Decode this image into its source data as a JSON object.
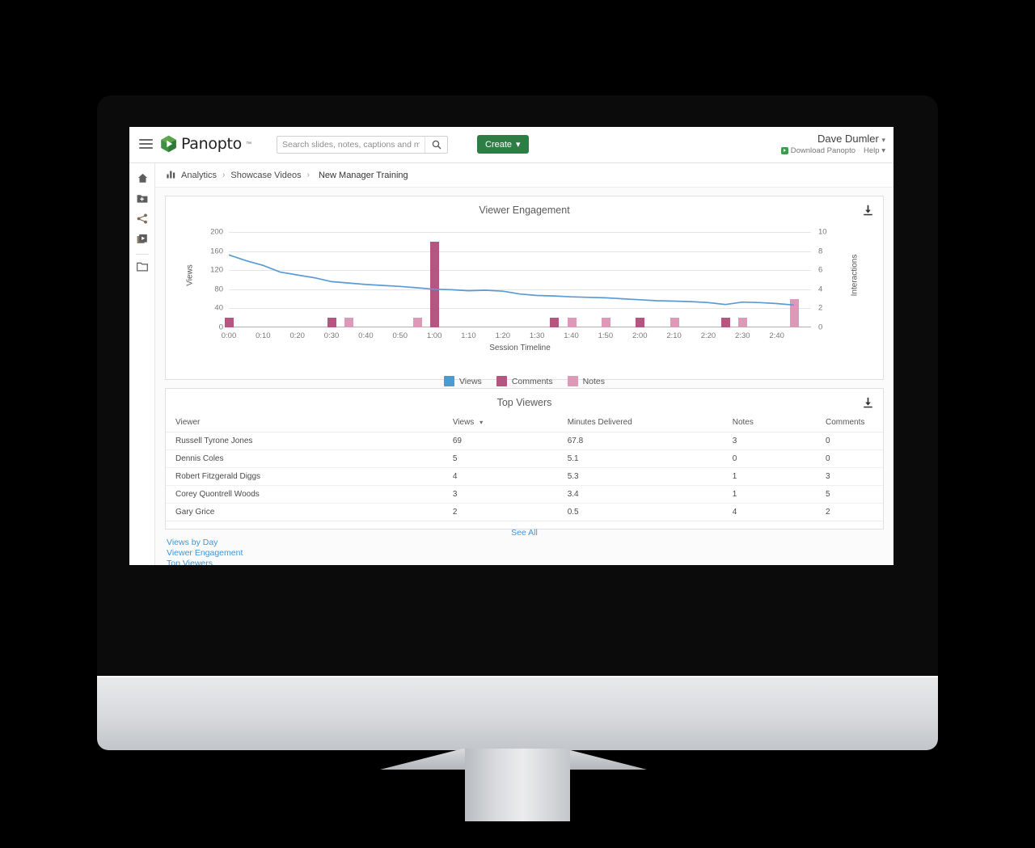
{
  "header": {
    "menu_icon": "hamburger-icon",
    "logo_text": "Panopto",
    "logo_tm": "™",
    "search_placeholder": "Search slides, notes, captions and more",
    "search_value": "",
    "search_icon": "search-icon",
    "create_label": "Create",
    "create_caret": "▾",
    "user_name": "Dave Dumler",
    "user_caret": "▾",
    "download_label": "Download Panopto",
    "help_label": "Help",
    "help_caret": "▾"
  },
  "sidebar": {
    "items": [
      {
        "icon": "home-icon",
        "name": "home"
      },
      {
        "icon": "add-folder-icon",
        "name": "my-folder"
      },
      {
        "icon": "share-icon",
        "name": "shared-with-me"
      },
      {
        "icon": "sessions-icon",
        "name": "everything"
      },
      {
        "icon": "folder-icon",
        "name": "browse-folder"
      }
    ]
  },
  "breadcrumb": {
    "icon": "analytics-bars-icon",
    "items": [
      "Analytics",
      "Showcase Videos",
      "New Manager Training"
    ],
    "separator": "›"
  },
  "chart_card": {
    "title": "Viewer Engagement",
    "download_icon": "download-icon"
  },
  "chart_data": {
    "type": "line",
    "title": "Viewer Engagement",
    "xlabel": "Session Timeline",
    "ylabel": "Views",
    "y2label": "Interactions",
    "ylim": [
      0,
      200
    ],
    "y2lim": [
      0,
      10
    ],
    "yticks": [
      0,
      40,
      80,
      120,
      160,
      200
    ],
    "y2ticks": [
      0,
      2,
      4,
      6,
      8,
      10
    ],
    "xticks": [
      "0:00",
      "0:10",
      "0:20",
      "0:30",
      "0:40",
      "0:50",
      "1:00",
      "1:10",
      "1:20",
      "1:30",
      "1:40",
      "1:50",
      "2:00",
      "2:10",
      "2:20",
      "2:30",
      "2:40"
    ],
    "xlim_minutes": [
      0,
      2.83
    ],
    "grid": true,
    "legend_position": "bottom",
    "series": [
      {
        "name": "Views",
        "type": "line",
        "color": "#5b9bd5",
        "x": [
          "0:00",
          "0:05",
          "0:10",
          "0:15",
          "0:20",
          "0:25",
          "0:30",
          "0:35",
          "0:40",
          "0:45",
          "0:50",
          "0:55",
          "1:00",
          "1:05",
          "1:10",
          "1:15",
          "1:20",
          "1:25",
          "1:30",
          "1:35",
          "1:40",
          "1:45",
          "1:50",
          "1:55",
          "2:00",
          "2:05",
          "2:10",
          "2:15",
          "2:20",
          "2:25",
          "2:30",
          "2:35",
          "2:40",
          "2:45"
        ],
        "values": [
          152,
          140,
          130,
          116,
          110,
          104,
          96,
          93,
          90,
          88,
          86,
          83,
          80,
          79,
          77,
          78,
          76,
          70,
          67,
          66,
          64,
          63,
          62,
          60,
          58,
          56,
          55,
          54,
          52,
          48,
          53,
          52,
          50,
          47
        ]
      },
      {
        "name": "Comments",
        "type": "bar",
        "color": "#b4567f",
        "points": [
          {
            "x": "0:00",
            "value": 1
          },
          {
            "x": "0:30",
            "value": 1
          },
          {
            "x": "1:00",
            "value": 9
          },
          {
            "x": "1:35",
            "value": 1
          },
          {
            "x": "2:00",
            "value": 1
          },
          {
            "x": "2:25",
            "value": 1
          }
        ]
      },
      {
        "name": "Notes",
        "type": "bar",
        "color": "#dd9ab8",
        "points": [
          {
            "x": "0:35",
            "value": 1
          },
          {
            "x": "0:55",
            "value": 1
          },
          {
            "x": "1:40",
            "value": 1
          },
          {
            "x": "1:50",
            "value": 1
          },
          {
            "x": "2:10",
            "value": 1
          },
          {
            "x": "2:30",
            "value": 1
          },
          {
            "x": "2:45",
            "value": 3
          }
        ]
      }
    ],
    "legend": [
      {
        "label": "Views",
        "color": "#4a9bd1"
      },
      {
        "label": "Comments",
        "color": "#b4567f"
      },
      {
        "label": "Notes",
        "color": "#dd9ab8"
      }
    ]
  },
  "table_card": {
    "title": "Top Viewers",
    "download_icon": "download-icon",
    "see_all_label": "See All",
    "sort_caret": "▾",
    "columns": [
      "Viewer",
      "Views",
      "Minutes Delivered",
      "Notes",
      "Comments"
    ],
    "sorted_column": "Views",
    "rows": [
      {
        "viewer": "Russell Tyrone Jones",
        "views": "69",
        "minutes": "67.8",
        "notes": "3",
        "comments": "0"
      },
      {
        "viewer": "Dennis Coles",
        "views": "5",
        "minutes": "5.1",
        "notes": "0",
        "comments": "0"
      },
      {
        "viewer": "Robert Fitzgerald Diggs",
        "views": "4",
        "minutes": "5.3",
        "notes": "1",
        "comments": "3"
      },
      {
        "viewer": "Corey Quontrell Woods",
        "views": "3",
        "minutes": "3.4",
        "notes": "1",
        "comments": "5"
      },
      {
        "viewer": "Gary Grice",
        "views": "2",
        "minutes": "0.5",
        "notes": "4",
        "comments": "2"
      }
    ]
  },
  "footer": {
    "links": [
      "Views by Day",
      "Viewer Engagement",
      "Top Viewers"
    ]
  },
  "colors": {
    "brand_green": "#2e7d45",
    "link_blue": "#3e96d6",
    "views_blue": "#5b9bd5",
    "comments_pink": "#b4567f",
    "notes_pink": "#dd9ab8"
  }
}
